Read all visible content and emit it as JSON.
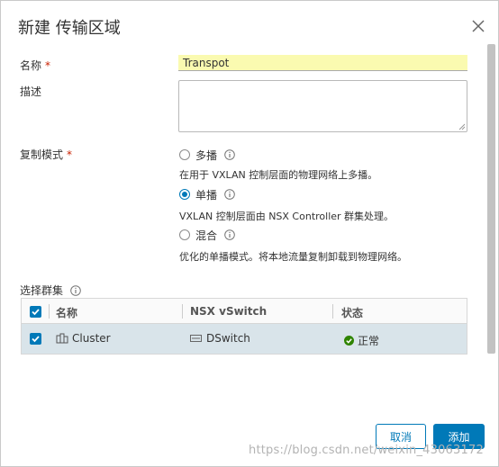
{
  "dialog": {
    "title": "新建 传输区域",
    "close_icon": "close-icon"
  },
  "form": {
    "name_label": "名称",
    "required_mark": "*",
    "name_value": "Transpot",
    "description_label": "描述",
    "description_value": "",
    "replication_label": "复制模式",
    "options": [
      {
        "label": "多播",
        "selected": false,
        "description": "在用于 VXLAN 控制层面的物理网络上多播。"
      },
      {
        "label": "单播",
        "selected": true,
        "description": "VXLAN 控制层面由 NSX Controller 群集处理。"
      },
      {
        "label": "混合",
        "selected": false,
        "description": "优化的单播模式。将本地流量复制卸载到物理网络。"
      }
    ],
    "cluster_label": "选择群集"
  },
  "grid": {
    "columns": [
      "名称",
      "NSX vSwitch",
      "状态"
    ],
    "rows": [
      {
        "name": "Cluster",
        "vswitch": "DSwitch",
        "status": "正常",
        "checked": true
      }
    ]
  },
  "buttons": {
    "cancel": "取消",
    "add": "添加"
  },
  "watermark": "https://blog.csdn.net/weixin_43063172",
  "colors": {
    "accent": "#0079b8",
    "highlight_input": "#fafab0",
    "status_ok": "#2f8400",
    "required": "#c92100"
  }
}
